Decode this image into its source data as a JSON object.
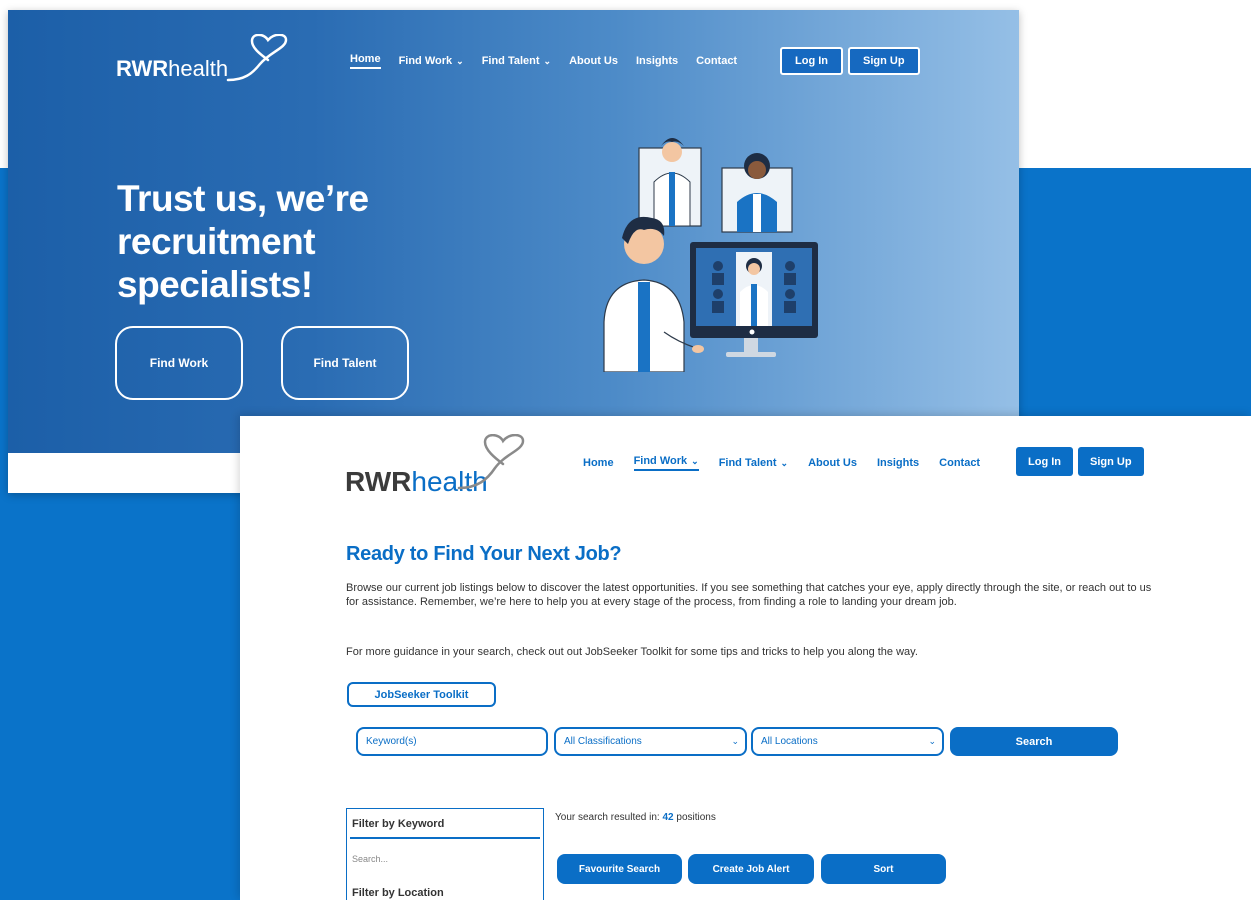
{
  "brand": {
    "bold": "RWR",
    "light": "health"
  },
  "colors": {
    "brand_blue": "#0a6ec6",
    "hero_gradient_start": "#1c5fa8",
    "hero_gradient_end": "#95bfe6",
    "background_band": "#0a73c9"
  },
  "hero": {
    "nav": [
      {
        "label": "Home",
        "dropdown": false,
        "active": true
      },
      {
        "label": "Find Work",
        "dropdown": true,
        "active": false
      },
      {
        "label": "Find Talent",
        "dropdown": true,
        "active": false
      },
      {
        "label": "About Us",
        "dropdown": false,
        "active": false
      },
      {
        "label": "Insights",
        "dropdown": false,
        "active": false
      },
      {
        "label": "Contact",
        "dropdown": false,
        "active": false
      }
    ],
    "login_label": "Log In",
    "signup_label": "Sign Up",
    "title": "Trust us, we’re recruitment specialists!",
    "cta_find_work": "Find Work",
    "cta_find_talent": "Find Talent",
    "illustration": "doctors-video-call-illustration"
  },
  "jobs": {
    "nav": [
      {
        "label": "Home",
        "dropdown": false,
        "active": false
      },
      {
        "label": "Find Work",
        "dropdown": true,
        "active": true
      },
      {
        "label": "Find Talent",
        "dropdown": true,
        "active": false
      },
      {
        "label": "About Us",
        "dropdown": false,
        "active": false
      },
      {
        "label": "Insights",
        "dropdown": false,
        "active": false
      },
      {
        "label": "Contact",
        "dropdown": false,
        "active": false
      }
    ],
    "login_label": "Log In",
    "signup_label": "Sign Up",
    "title": "Ready to Find Your Next Job?",
    "intro": "Browse our current job listings below to discover the latest opportunities. If you see something that catches your eye, apply directly through the site, or reach out to us for assistance. Remember, we’re here to help you at every stage of the process, from finding a role to landing your dream job.",
    "guidance": "For more guidance in your search, check out out JobSeeker Toolkit for some tips and tricks to help you along the way.",
    "toolkit_button": "JobSeeker Toolkit",
    "search": {
      "keyword_placeholder": "Keyword(s)",
      "classification_value": "All Classifications",
      "location_value": "All Locations",
      "button": "Search"
    },
    "filters": {
      "keyword_title": "Filter by Keyword",
      "search_placeholder": "Search...",
      "location_title": "Filter by Location"
    },
    "results": {
      "prefix": "Your search resulted in:",
      "count": "42",
      "suffix": "positions"
    },
    "actions": {
      "favourite": "Favourite Search",
      "job_alert": "Create Job Alert",
      "sort": "Sort"
    }
  }
}
